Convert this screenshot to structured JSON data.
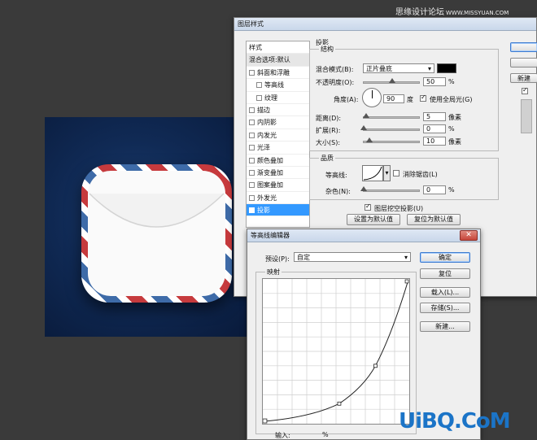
{
  "watermark_top": {
    "text": "思缘设计论坛",
    "url": "WWW.MISSYUAN.COM"
  },
  "layer_style": {
    "title": "图层样式",
    "styles_header": "样式",
    "blend_options": "混合选项:默认",
    "items": [
      {
        "label": "斜面和浮雕",
        "checked": false,
        "sub": false
      },
      {
        "label": "等高线",
        "checked": false,
        "sub": true
      },
      {
        "label": "纹理",
        "checked": false,
        "sub": true
      },
      {
        "label": "描边",
        "checked": false,
        "sub": false
      },
      {
        "label": "内阴影",
        "checked": false,
        "sub": false
      },
      {
        "label": "内发光",
        "checked": false,
        "sub": false
      },
      {
        "label": "光泽",
        "checked": false,
        "sub": false
      },
      {
        "label": "颜色叠加",
        "checked": false,
        "sub": false
      },
      {
        "label": "渐变叠加",
        "checked": false,
        "sub": false
      },
      {
        "label": "图案叠加",
        "checked": false,
        "sub": false
      },
      {
        "label": "外发光",
        "checked": false,
        "sub": false
      },
      {
        "label": "投影",
        "checked": true,
        "sub": false
      }
    ],
    "section_title": "投影",
    "structure_title": "结构",
    "blend_mode_label": "混合模式(B):",
    "blend_mode_value": "正片叠底",
    "shadow_color": "#000000",
    "opacity_label": "不透明度(O):",
    "opacity_value": "50",
    "angle_label": "角度(A):",
    "angle_value": "90",
    "angle_unit": "度",
    "global_light_label": "使用全局光(G)",
    "distance_label": "距离(D):",
    "distance_value": "5",
    "spread_label": "扩展(R):",
    "spread_value": "0",
    "size_label": "大小(S):",
    "size_value": "10",
    "px_unit": "像素",
    "pct_unit": "%",
    "quality_title": "品质",
    "contour_label": "等高线:",
    "anti_alias_label": "消除锯齿(L)",
    "noise_label": "杂色(N):",
    "noise_value": "0",
    "knockout_label": "图层挖空投影(U)",
    "set_default": "设置为默认值",
    "reset_default": "复位为默认值",
    "new_style": "新建"
  },
  "curves_editor": {
    "title": "等高线编辑器",
    "preset_label": "预设(P):",
    "preset_value": "自定",
    "mapping_label": "映射",
    "ok": "确定",
    "reset": "复位",
    "load": "载入(L)...",
    "save": "存储(S)...",
    "new": "新建...",
    "input_label": "输入:",
    "pct": "%"
  },
  "watermark": {
    "text": "UiBQ.CoM"
  },
  "colors": {
    "accent": "#3399ff",
    "stripe_red": "#c63a3d",
    "stripe_blue": "#3e6ba8"
  }
}
